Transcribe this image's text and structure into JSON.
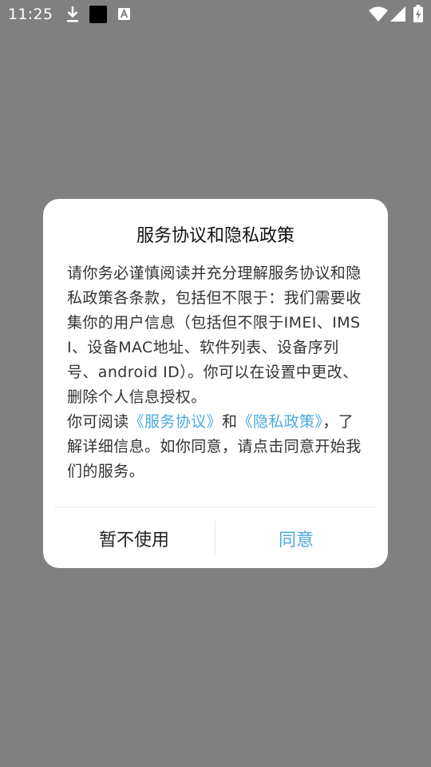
{
  "status_bar": {
    "time": "11:25",
    "icons": [
      "download-icon",
      "black-square-icon",
      "a-icon",
      "wifi-icon",
      "signal-icon",
      "battery-charging-icon"
    ]
  },
  "dialog": {
    "title": "服务协议和隐私政策",
    "paragraph1": "请你务必谨慎阅读并充分理解服务协议和隐私政策各条款，包括但不限于：我们需要收集你的用户信息（包括但不限于IMEI、IMSI、设备MAC地址、软件列表、设备序列号、android ID）。你可以在设置中更改、删除个人信息授权。",
    "paragraph2_prefix": "你可阅读",
    "link_service": "《服务协议》",
    "paragraph2_and": "和",
    "link_privacy": "《隐私政策》",
    "paragraph2_suffix": "，了解详细信息。如你同意，请点击同意开始我们的服务。",
    "decline_label": "暂不使用",
    "agree_label": "同意"
  },
  "colors": {
    "overlay": "#808080",
    "link": "#4aa9e0",
    "dialog_bg": "#ffffff"
  }
}
